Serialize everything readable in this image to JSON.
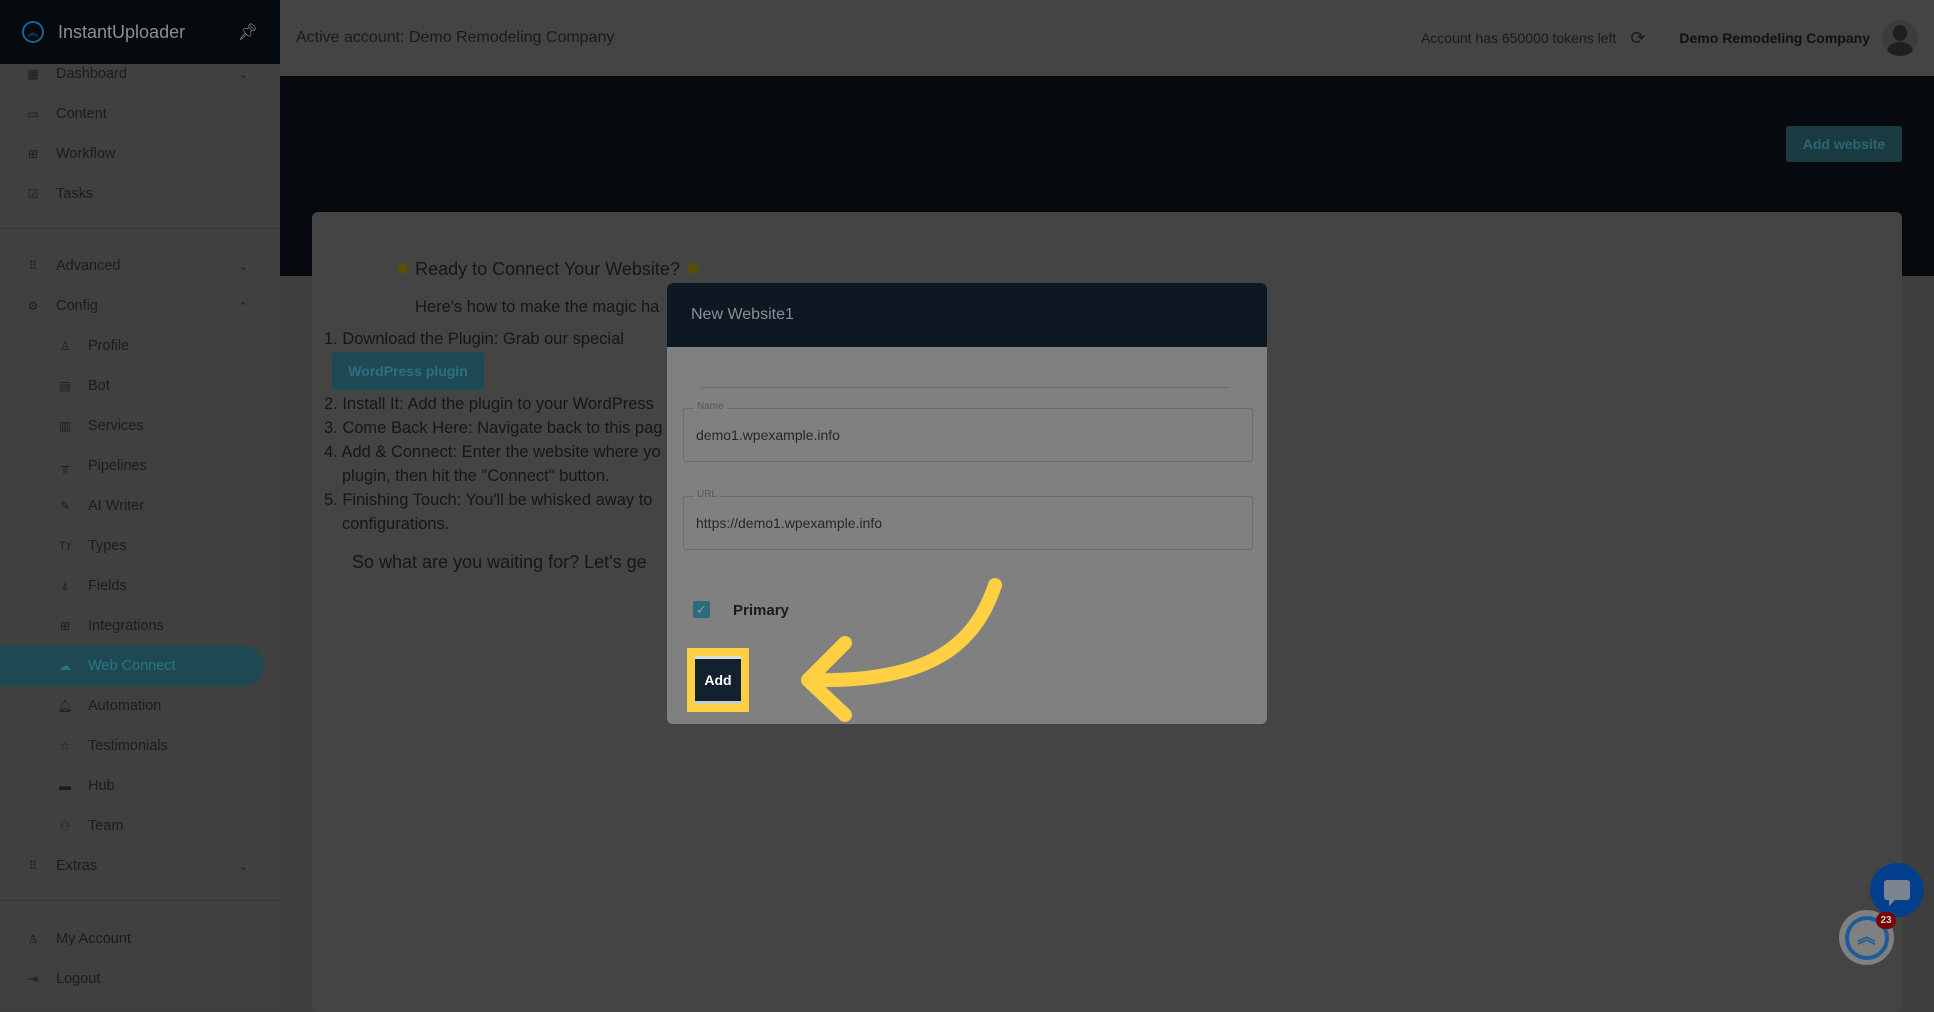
{
  "brand": {
    "name": "InstantUploader",
    "logo_icon": "double-chevron-up-icon",
    "pin_icon": "pin-icon"
  },
  "topbar": {
    "active_account": "Active account: Demo Remodeling Company",
    "tokens": "Account has 650000 tokens left",
    "company": "Demo Remodeling Company"
  },
  "sidebar": {
    "items": [
      {
        "label": "Dashboard",
        "icon": "grid-icon",
        "chevron": "down"
      },
      {
        "label": "Content",
        "icon": "folder-icon"
      },
      {
        "label": "Workflow",
        "icon": "board-icon"
      },
      {
        "label": "Tasks",
        "icon": "checkbox-icon"
      },
      {
        "label": "Advanced",
        "icon": "apps-icon",
        "chevron": "down"
      },
      {
        "label": "Config",
        "icon": "gear-icon",
        "chevron": "up"
      },
      {
        "label": "Profile",
        "icon": "user-icon",
        "sub": true
      },
      {
        "label": "Bot",
        "icon": "message-icon",
        "sub": true
      },
      {
        "label": "Services",
        "icon": "building-icon",
        "sub": true
      },
      {
        "label": "Pipelines",
        "icon": "pipeline-icon",
        "sub": true
      },
      {
        "label": "AI Writer",
        "icon": "pencil-icon",
        "sub": true
      },
      {
        "label": "Types",
        "icon": "text-type-icon",
        "sub": true
      },
      {
        "label": "Fields",
        "icon": "fields-icon",
        "sub": true
      },
      {
        "label": "Integrations",
        "icon": "plus-square-icon",
        "sub": true
      },
      {
        "label": "Web Connect",
        "icon": "cloud-icon",
        "sub": true,
        "active": true
      },
      {
        "label": "Automation",
        "icon": "bell-icon",
        "sub": true
      },
      {
        "label": "Testimonials",
        "icon": "star-icon",
        "sub": true
      },
      {
        "label": "Hub",
        "icon": "hub-icon",
        "sub": true
      },
      {
        "label": "Team",
        "icon": "team-icon",
        "sub": true
      },
      {
        "label": "Extras",
        "icon": "apps-icon",
        "chevron": "down"
      },
      {
        "label": "My Account",
        "icon": "user-icon"
      },
      {
        "label": "Logout",
        "icon": "logout-icon"
      }
    ]
  },
  "main": {
    "add_website": "Add website",
    "heading": "Ready to Connect Your Website?",
    "intro": "Here's how to make the magic ha",
    "steps": [
      "1. Download the Plugin: Grab our special",
      "2. Install It: Add the plugin to your WordPress",
      "3. Come Back Here: Navigate back to this pag",
      "4. Add & Connect: Enter the website where yo",
      "plugin, then hit the \"Connect\" button.",
      "5. Finishing Touch: You'll be whisked away to",
      "configurations."
    ],
    "plugin_button": "WordPress plugin",
    "outro": "So what are you waiting for? Let's ge"
  },
  "modal": {
    "title": "New Website1",
    "name_label": "Name",
    "name_value": "demo1.wpexample.info",
    "url_label": "URL",
    "url_value": "https://demo1.wpexample.info",
    "primary_label": "Primary",
    "primary_checked": true,
    "add_label": "Add"
  },
  "widgets": {
    "badge_count": "23"
  },
  "colors": {
    "highlight": "#ffd044",
    "accent": "#2d6a7d",
    "modal_header": "#0e1822"
  }
}
